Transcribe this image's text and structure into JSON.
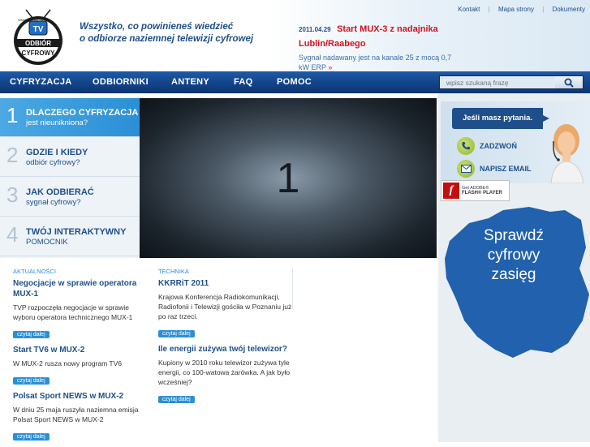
{
  "header": {
    "logo": {
      "line1": "ODBIÓR",
      "line2": "CYFROWY",
      "tv": "TV",
      "arc_text": "Strefa cyfrowy na"
    },
    "slogan_line1": "Wszystko, co powinieneś wiedzieć",
    "slogan_line2": "o odbiorze naziemnej telewizji cyfrowej",
    "ticker": {
      "date": "2011.04.29",
      "title": "Start MUX-3 z nadajnika Lublin/Raabego",
      "text": "Sygnał nadawany jest na kanale 25 z mocą 0,7 kW ERP",
      "arrow": "»"
    },
    "toplinks": [
      "Kontakt",
      "Mapa strony",
      "Dokumenty"
    ],
    "toplinks_separator": "|"
  },
  "nav": {
    "items": [
      "CYFRYZACJA",
      "ODBIORNIKI",
      "ANTENY",
      "FAQ",
      "POMOC"
    ],
    "search_placeholder": "wpisz szukaną frazę"
  },
  "tabs": [
    {
      "num": "1",
      "line1": "DLACZEGO CYFRYZACJA",
      "line2": "jest nieunikniona?"
    },
    {
      "num": "2",
      "line1": "GDZIE I KIEDY",
      "line2": "odbiór cyfrowy?"
    },
    {
      "num": "3",
      "line1": "JAK ODBIERAĆ",
      "line2": "sygnał cyfrowy?"
    },
    {
      "num": "4",
      "line1": "TWÓJ INTERAKTYWNY",
      "line2": "POMOCNIK"
    }
  ],
  "stage": {
    "number": "1"
  },
  "news": {
    "left": {
      "category": "AKTUALNOŚCI",
      "articles": [
        {
          "title": "Negocjacje w sprawie operatora MUX-1",
          "text": "TVP rozpoczęła negocjacje w sprawie wyboru operatora technicznego MUX-1",
          "more": "czytaj dalej"
        },
        {
          "title": "Start TV6 w MUX-2",
          "text": "W MUX-2 rusza nowy program TV6",
          "more": "czytaj dalej"
        },
        {
          "title": "Polsat Sport NEWS w MUX-2",
          "text": "W dniu 25 maja ruszyła naziemna emisja Polsat Sport NEWS w MUX-2",
          "more": "czytaj dalej"
        }
      ]
    },
    "right": {
      "category": "TECHNIKA",
      "articles": [
        {
          "title": "KKRRiT 2011",
          "text": "Krajowa Konferencja Radiokomunikacji, Radiofonii i Telewizji gościła w Poznaniu już po raz trzeci.",
          "more": "czytaj dalej"
        },
        {
          "title": "Ile energii zużywa twój telewizor?",
          "text": "Kupiony w 2010 roku telewizor zużywa tyle energii, co 100-watowa żarówka. A jak było wcześniej?",
          "more": "czytaj dalej"
        }
      ]
    }
  },
  "sidebar": {
    "contact_heading": "Jeśli masz pytania.",
    "call": "ZADZWOŃ",
    "email": "NAPISZ EMAIL",
    "flash": {
      "line1": "Get ADOBE®",
      "line2": "FLASH® PLAYER",
      "icon": "f"
    },
    "map_line1": "Sprawdź",
    "map_line2": "cyfrowy",
    "map_line3": "zasięg"
  },
  "colors": {
    "brand_blue": "#1f4f8a",
    "accent_blue": "#2b8fd6",
    "nav_blue": "#134388",
    "ticker_red": "#d4121e",
    "map_blue": "#2161ad"
  }
}
